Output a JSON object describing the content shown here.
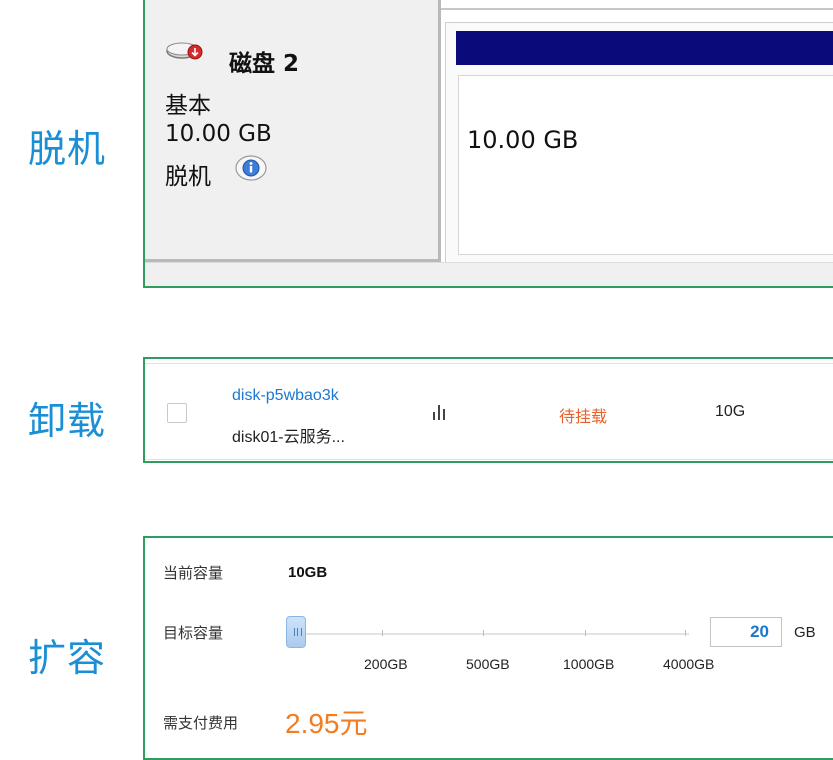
{
  "sections": {
    "offline_label": "脱机",
    "unmount_label": "卸载",
    "expand_label": "扩容"
  },
  "disk_manager": {
    "disk_title": "磁盘 2",
    "disk_type": "基本",
    "disk_size": "10.00 GB",
    "disk_status": "脱机",
    "volume_size": "10.00 GB",
    "volume_bar_color": "#0a0a7a",
    "icons": [
      "disk-offline-icon",
      "info-icon"
    ]
  },
  "disk_row": {
    "disk_id": "disk-p5wbao3k",
    "disk_name": "disk01-云服务...",
    "status": "待挂载",
    "size": "10G",
    "status_color": "#e8622c",
    "icons": [
      "monitor-chart-icon"
    ]
  },
  "expand": {
    "current_label": "当前容量",
    "current_value": "10GB",
    "target_label": "目标容量",
    "target_value": "20",
    "unit": "GB",
    "ticks": [
      "200GB",
      "500GB",
      "1000GB",
      "4000GB"
    ],
    "cost_label": "需支付费用",
    "cost_value": "2.95元",
    "accent_color": "#f47c20"
  }
}
